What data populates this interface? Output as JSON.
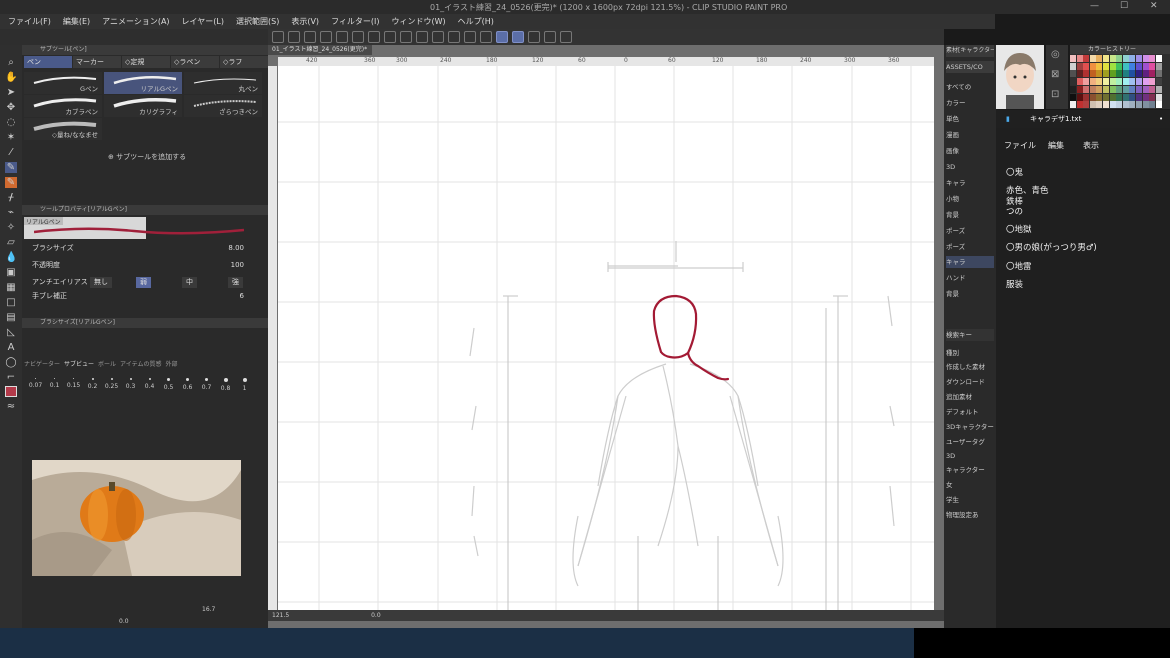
{
  "window": {
    "title": "01_イラスト練習_24_0526(更完)* (1200 x 1600px 72dpi 121.5%) - CLIP STUDIO PAINT PRO",
    "menu": [
      "ファイル(F)",
      "編集(E)",
      "アニメーション(A)",
      "レイヤー(L)",
      "選択範囲(S)",
      "表示(V)",
      "フィルター(I)",
      "ウィンドウ(W)",
      "ヘルプ(H)"
    ]
  },
  "subtool_panel": {
    "header": "サブツール[ペン]",
    "tabs": [
      "ペン",
      "マーカー",
      "◇定規",
      "◇ラペン",
      "◇ラフ"
    ],
    "brushes": [
      "Gペン",
      "リアルGペン",
      "丸ペン",
      "カブラペン",
      "カリグラフィ",
      "ざらつきペン",
      "◇量ね/ななませ"
    ],
    "add_label": "サブツールを追加する"
  },
  "tool_property": {
    "header": "ツールプロパティ[リアルGペン]",
    "preview_label": "リアルGペン",
    "brush_size_label": "ブラシサイズ",
    "brush_size_value": "8.00",
    "opacity_label": "不透明度",
    "opacity_value": "100",
    "antialias_label": "アンチエイリアス",
    "antialias_options": [
      "無し",
      "弱",
      "中",
      "強"
    ],
    "antialias_selected": 1,
    "stabilization_label": "手ブレ補正",
    "stabilization_value": "6"
  },
  "brush_size_panel": {
    "header": "ブラシサイズ[リアルGペン]",
    "sizes": [
      "0.07",
      "0.1",
      "0.15",
      "0.2",
      "0.25",
      "0.3",
      "0.4",
      "0.5",
      "0.6",
      "0.7",
      "0.8",
      "1"
    ]
  },
  "nav_panel": {
    "tabs": [
      "ナビゲーター",
      "サブビュー",
      "ボール",
      "アイテムの質感",
      "外部"
    ],
    "zoom": "16.7",
    "angle": "0.0"
  },
  "canvas": {
    "tab_label": "01_イラスト練習_24_0526(更完)*",
    "ruler_ticks": [
      "420",
      "360",
      "300",
      "240",
      "180",
      "120",
      "60",
      "0",
      "60",
      "120",
      "180",
      "240",
      "300",
      "360",
      "420"
    ],
    "zoom_status": "121.5",
    "angle_status": "0.0"
  },
  "material_panel": {
    "header": "素材[キャラクター]",
    "root": "ASSETS/CO",
    "tree": [
      "すべての",
      "カラー",
      "単色",
      "漫画",
      "画像",
      "3D",
      "キャラ",
      "小物",
      "背景",
      "ポーズ",
      "ポーズ",
      "キャラ",
      "ハンド",
      "背景"
    ],
    "search": "検索キー",
    "categories_label": "種別",
    "categories": [
      "作成した素材",
      "ダウンロード",
      "追加素材",
      "デフォルト",
      "3Dキャラクター",
      "ユーザータグ",
      "3D",
      "キャラクター",
      "女",
      "学生",
      "物理設定あ"
    ]
  },
  "color_history": {
    "header": "カラーヒストリー",
    "colors": [
      "#f2c0c0",
      "#e88a8a",
      "#c23b3b",
      "#f4d9a8",
      "#e8b060",
      "#f2e68a",
      "#c8e68a",
      "#8fd08f",
      "#8fd0d0",
      "#8fb0e8",
      "#a08fe8",
      "#d08fe8",
      "#e88fd0",
      "#ffffff",
      "#d0d0d0",
      "#a04040",
      "#e05050",
      "#f09040",
      "#f0c040",
      "#e0e040",
      "#a0e040",
      "#40c060",
      "#40c0c0",
      "#4080e0",
      "#6050d0",
      "#a050d0",
      "#e050a0",
      "#a0a0a0",
      "#505050",
      "#602020",
      "#b03030",
      "#c06020",
      "#c09020",
      "#a0a020",
      "#60a020",
      "#208040",
      "#208080",
      "#2050a0",
      "#302080",
      "#602080",
      "#a02060",
      "#707070",
      "#303030",
      "#e06060",
      "#f0a0a0",
      "#f0b080",
      "#f0d080",
      "#f0f0a0",
      "#c0f0a0",
      "#a0f0c0",
      "#a0f0f0",
      "#a0c0f0",
      "#b0a0f0",
      "#e0a0f0",
      "#f0a0d0",
      "#404040",
      "#202020",
      "#8a2020",
      "#d07070",
      "#c08060",
      "#d0a060",
      "#c0c060",
      "#80c060",
      "#60a080",
      "#60a0a0",
      "#6080c0",
      "#8060c0",
      "#a060c0",
      "#c06090",
      "#b0b0b0",
      "#101010",
      "#5a1010",
      "#9a3030",
      "#8a5030",
      "#8a7030",
      "#707030",
      "#507030",
      "#307050",
      "#307070",
      "#304f80",
      "#503080",
      "#703080",
      "#803050",
      "#e0e0e0",
      "#f0f0f0",
      "#c03030",
      "#b04040",
      "#d0c0b0",
      "#e0d0c0",
      "#f0e0d0",
      "#d0e0f0",
      "#c0d0e0",
      "#b0c0d0",
      "#a0b0c0",
      "#90a0b0",
      "#8090a0",
      "#708090",
      "#ffffff"
    ]
  },
  "notepad": {
    "filename": "キャラデザ1.txt",
    "menu": [
      "ファイル",
      "編集",
      "表示"
    ],
    "lines": [
      "〇鬼",
      "赤色、青色",
      "鉄棒",
      "つの",
      "〇地獄",
      "〇男の娘(がっつり男♂)",
      "〇地雷",
      "服装"
    ]
  },
  "theme": {
    "accent": "#5b6ea8",
    "stroke": "#8b1a2a",
    "taskbar": "#1b2f45"
  }
}
